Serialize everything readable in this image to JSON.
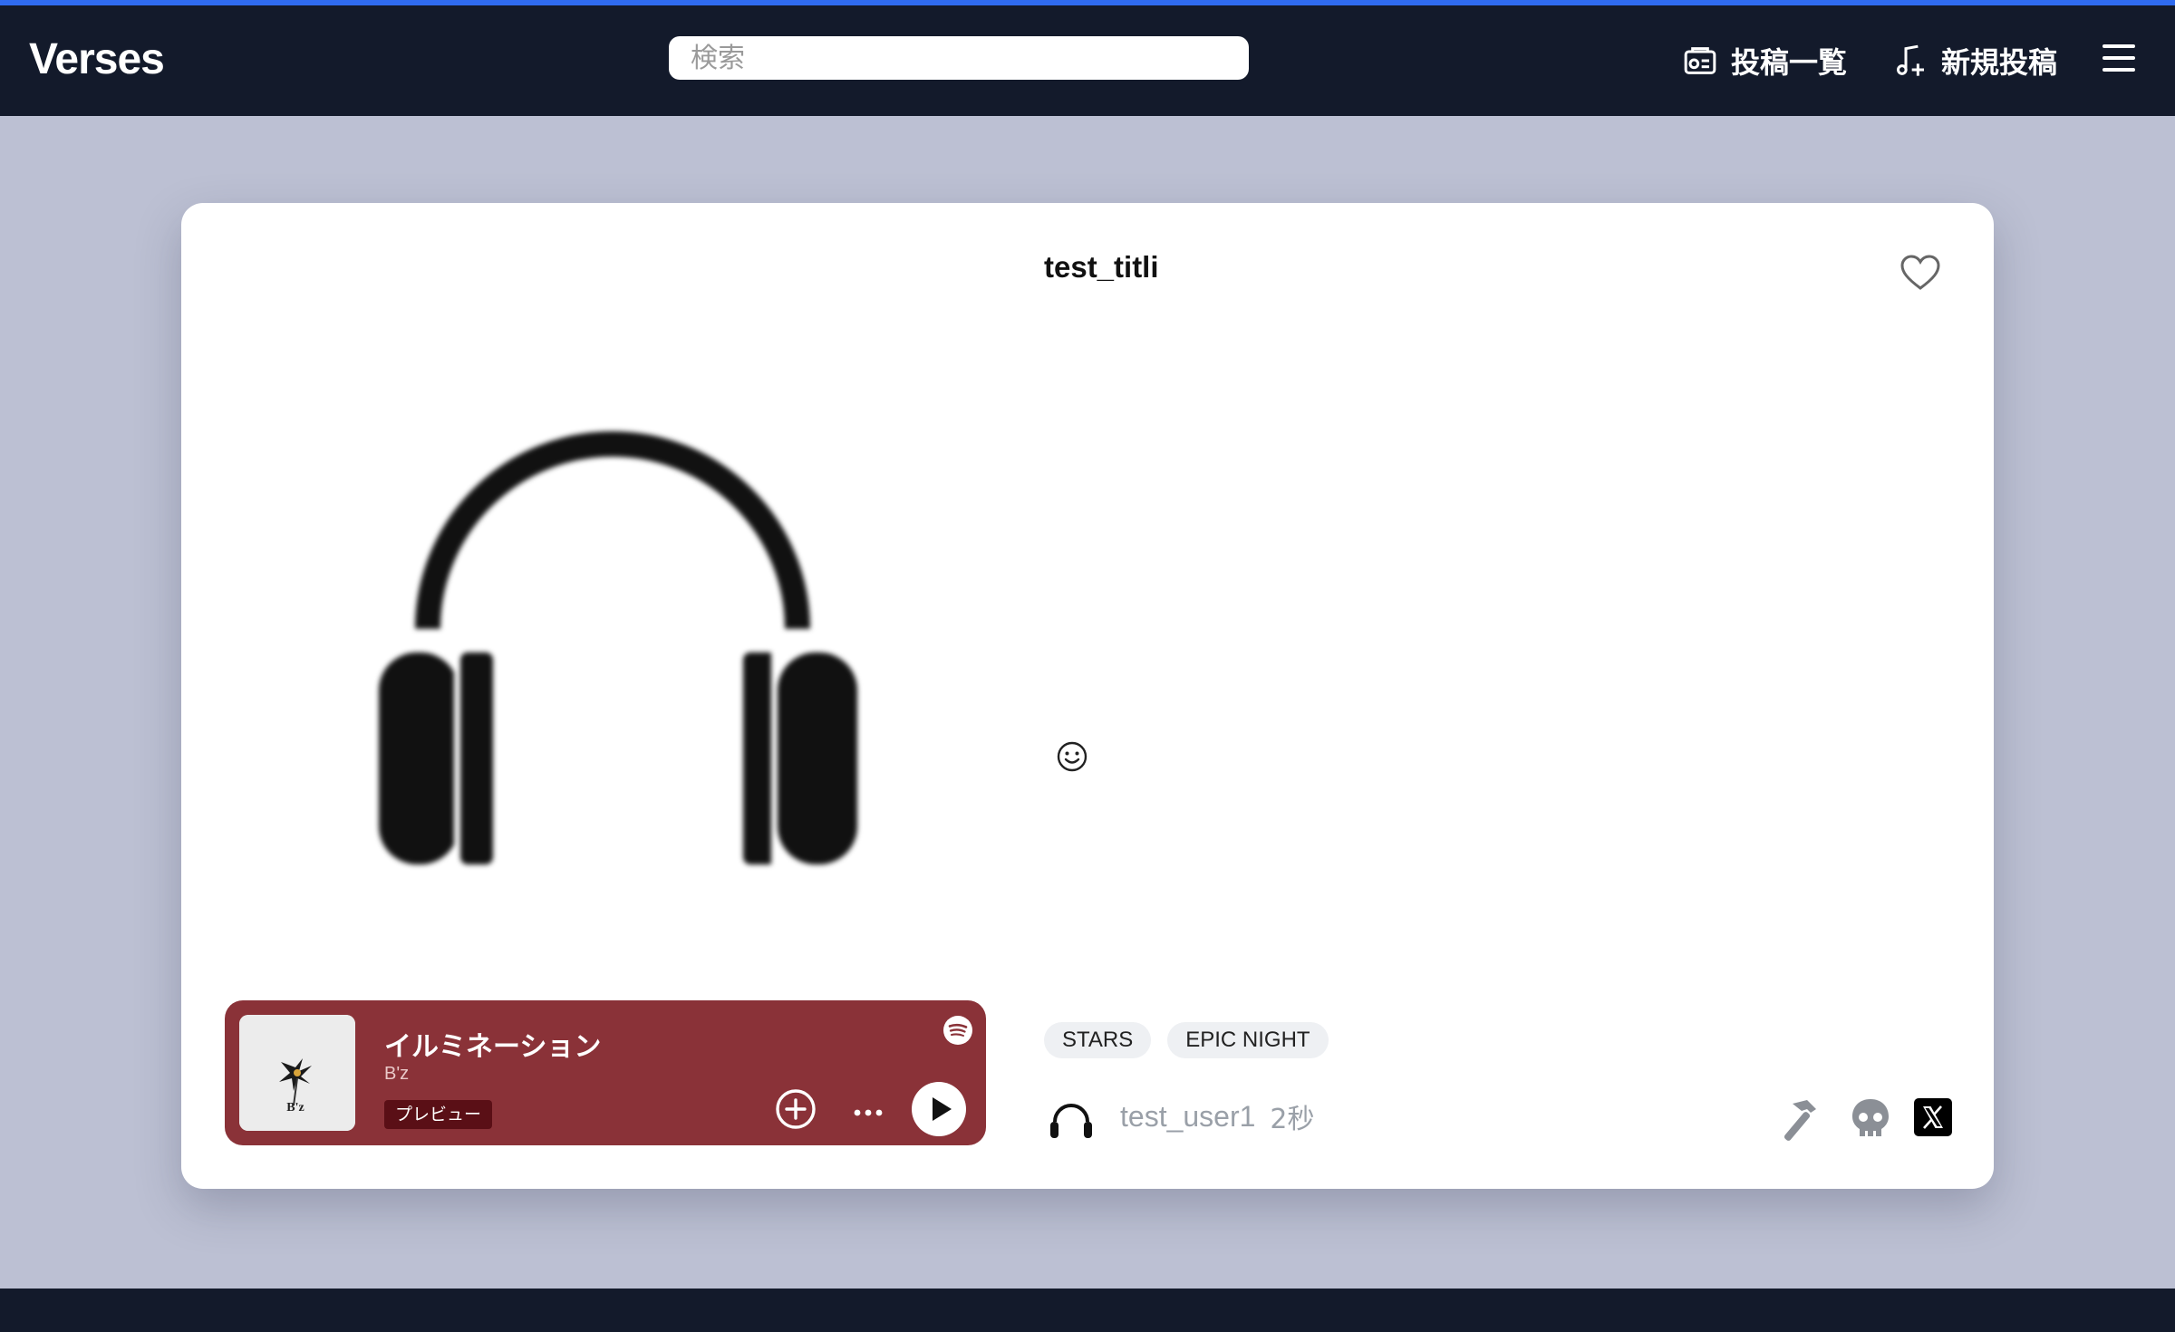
{
  "app": {
    "brand": "Verses"
  },
  "search": {
    "placeholder": "検索"
  },
  "nav": {
    "posts_label": "投稿一覧",
    "new_post_label": "新規投稿"
  },
  "post": {
    "title": "test_titli",
    "tags": [
      "STARS",
      "EPIC NIGHT"
    ],
    "username": "test_user1",
    "time": "2秒"
  },
  "player": {
    "track_title": "イルミネーション",
    "artist": "B'z",
    "preview_label": "プレビュー",
    "album_art_text": "B'z"
  },
  "colors": {
    "accent": "#2f6bf0",
    "navbar": "#131a2b",
    "page_bg": "#bcc0d3",
    "player_bg": "#8a3238"
  },
  "icons": [
    "posts-list-icon",
    "music-add-icon",
    "menu-icon",
    "headphones-icon",
    "heart-icon",
    "emoji-icon",
    "spotify-icon",
    "add-circle-icon",
    "more-icon",
    "play-icon",
    "hammer-icon",
    "skull-icon",
    "x-logo-icon"
  ]
}
